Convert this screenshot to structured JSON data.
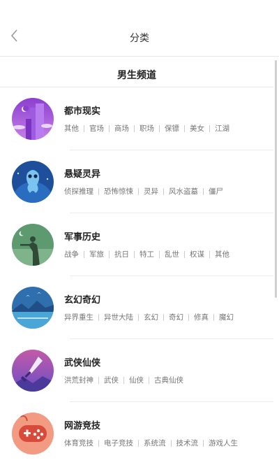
{
  "header": {
    "title": "分类",
    "back_icon": "chevron-left-icon"
  },
  "channel": {
    "title": "男生频道"
  },
  "categories": [
    {
      "name": "都市现实",
      "icon": "city-buildings-icon",
      "tags": [
        "其他",
        "官场",
        "商场",
        "职场",
        "保镖",
        "美女",
        "江湖"
      ]
    },
    {
      "name": "悬疑灵异",
      "icon": "ghost-icon",
      "tags": [
        "侦探推理",
        "恐怖惊悚",
        "灵异",
        "风水盗墓",
        "僵尸"
      ]
    },
    {
      "name": "军事历史",
      "icon": "soldier-rifle-icon",
      "tags": [
        "战争",
        "军旅",
        "抗日",
        "特工",
        "乱世",
        "权谋",
        "其他"
      ]
    },
    {
      "name": "玄幻奇幻",
      "icon": "fantasy-landscape-icon",
      "tags": [
        "异界重生",
        "异世大陆",
        "玄幻",
        "奇幻",
        "修真",
        "魔幻"
      ]
    },
    {
      "name": "武侠仙侠",
      "icon": "sword-icon",
      "tags": [
        "洪荒封神",
        "武侠",
        "仙侠",
        "古典仙侠"
      ]
    },
    {
      "name": "网游竞技",
      "icon": "gamepad-icon",
      "tags": [
        "体育竞技",
        "电子竞技",
        "系统流",
        "技术流",
        "游戏人生"
      ]
    }
  ],
  "colors": {
    "city": "#a35bd6",
    "ghost": "#1c5aa8",
    "military": "#5a8f6a",
    "fantasy": "#3d8ec9",
    "wuxia": "#9b5fc4",
    "game": "#ef8a74"
  }
}
